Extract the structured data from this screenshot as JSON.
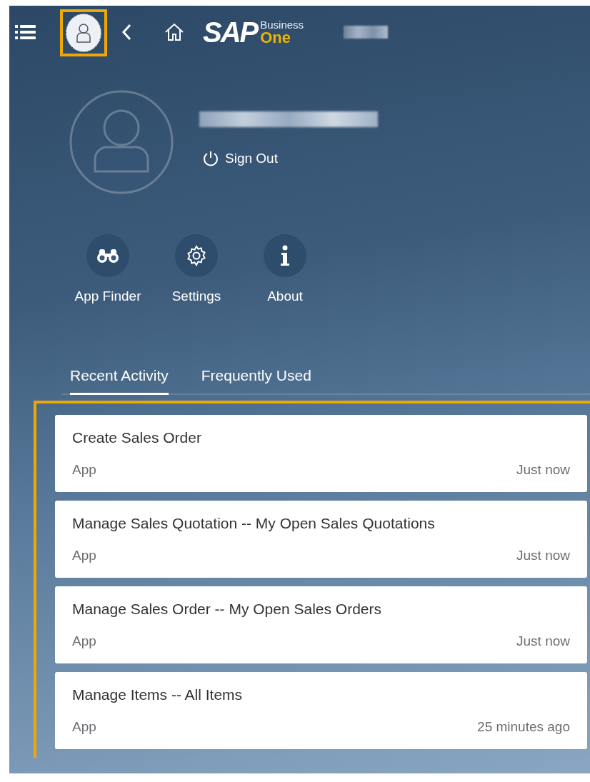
{
  "logo": {
    "brand": "SAP",
    "line_1": "Business",
    "line_2": "One"
  },
  "profile": {
    "sign_out": "Sign Out"
  },
  "actions": [
    {
      "kind": "finder",
      "label": "App Finder"
    },
    {
      "kind": "settings",
      "label": "Settings"
    },
    {
      "kind": "about",
      "label": "About"
    }
  ],
  "tabs": [
    {
      "label": "Recent Activity",
      "selected": true
    },
    {
      "label": "Frequently Used",
      "selected": false
    }
  ],
  "activities": [
    {
      "title": "Create Sales Order",
      "type": "App",
      "time": "Just now"
    },
    {
      "title": "Manage Sales Quotation -- My Open Sales Quotations",
      "type": "App",
      "time": "Just now"
    },
    {
      "title": "Manage Sales Order -- My Open Sales Orders",
      "type": "App",
      "time": "Just now"
    },
    {
      "title": "Manage Items -- All Items",
      "type": "App",
      "time": "25 minutes ago"
    }
  ]
}
